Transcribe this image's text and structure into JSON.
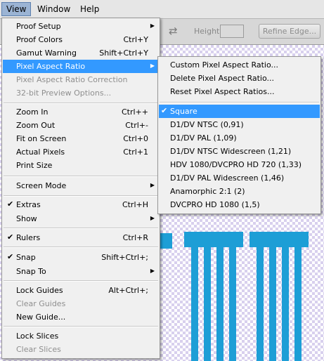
{
  "menubar": {
    "items": [
      "View",
      "Window",
      "Help"
    ]
  },
  "optionsbar": {
    "height_label": "Height:",
    "refine_label": "Refine Edge..."
  },
  "view_menu": {
    "items": [
      {
        "label": "Proof Setup",
        "shortcut": "",
        "submenu": true,
        "checked": false,
        "disabled": false
      },
      {
        "label": "Proof Colors",
        "shortcut": "Ctrl+Y",
        "submenu": false,
        "checked": false,
        "disabled": false
      },
      {
        "label": "Gamut Warning",
        "shortcut": "Shift+Ctrl+Y",
        "submenu": false,
        "checked": false,
        "disabled": false
      },
      {
        "label": "Pixel Aspect Ratio",
        "shortcut": "",
        "submenu": true,
        "checked": false,
        "disabled": false,
        "highlighted": true
      },
      {
        "label": "Pixel Aspect Ratio Correction",
        "shortcut": "",
        "submenu": false,
        "checked": false,
        "disabled": true
      },
      {
        "label": "32-bit Preview Options...",
        "shortcut": "",
        "submenu": false,
        "checked": false,
        "disabled": true
      },
      {
        "label": "Zoom In",
        "shortcut": "Ctrl++",
        "submenu": false,
        "checked": false,
        "disabled": false
      },
      {
        "label": "Zoom Out",
        "shortcut": "Ctrl+-",
        "submenu": false,
        "checked": false,
        "disabled": false
      },
      {
        "label": "Fit on Screen",
        "shortcut": "Ctrl+0",
        "submenu": false,
        "checked": false,
        "disabled": false
      },
      {
        "label": "Actual Pixels",
        "shortcut": "Ctrl+1",
        "submenu": false,
        "checked": false,
        "disabled": false
      },
      {
        "label": "Print Size",
        "shortcut": "",
        "submenu": false,
        "checked": false,
        "disabled": false
      },
      {
        "label": "Screen Mode",
        "shortcut": "",
        "submenu": true,
        "checked": false,
        "disabled": false
      },
      {
        "label": "Extras",
        "shortcut": "Ctrl+H",
        "submenu": false,
        "checked": true,
        "disabled": false
      },
      {
        "label": "Show",
        "shortcut": "",
        "submenu": true,
        "checked": false,
        "disabled": false
      },
      {
        "label": "Rulers",
        "shortcut": "Ctrl+R",
        "submenu": false,
        "checked": true,
        "disabled": false
      },
      {
        "label": "Snap",
        "shortcut": "Shift+Ctrl+;",
        "submenu": false,
        "checked": true,
        "disabled": false
      },
      {
        "label": "Snap To",
        "shortcut": "",
        "submenu": true,
        "checked": false,
        "disabled": false
      },
      {
        "label": "Lock Guides",
        "shortcut": "Alt+Ctrl+;",
        "submenu": false,
        "checked": false,
        "disabled": false
      },
      {
        "label": "Clear Guides",
        "shortcut": "",
        "submenu": false,
        "checked": false,
        "disabled": true
      },
      {
        "label": "New Guide...",
        "shortcut": "",
        "submenu": false,
        "checked": false,
        "disabled": false
      },
      {
        "label": "Lock Slices",
        "shortcut": "",
        "submenu": false,
        "checked": false,
        "disabled": false
      },
      {
        "label": "Clear Slices",
        "shortcut": "",
        "submenu": false,
        "checked": false,
        "disabled": true
      }
    ]
  },
  "pixel_aspect_submenu": {
    "items": [
      {
        "label": "Custom Pixel Aspect Ratio...",
        "checked": false
      },
      {
        "label": "Delete Pixel Aspect Ratio...",
        "checked": false
      },
      {
        "label": "Reset Pixel Aspect Ratios...",
        "checked": false
      },
      {
        "label": "Square",
        "checked": true,
        "highlighted": true
      },
      {
        "label": "D1/DV NTSC (0,91)",
        "checked": false
      },
      {
        "label": "D1/DV PAL (1,09)",
        "checked": false
      },
      {
        "label": "D1/DV NTSC Widescreen (1,21)",
        "checked": false
      },
      {
        "label": "HDV 1080/DVCPRO HD 720 (1,33)",
        "checked": false
      },
      {
        "label": "D1/DV PAL Widescreen (1,46)",
        "checked": false
      },
      {
        "label": "Anamorphic 2:1 (2)",
        "checked": false
      },
      {
        "label": "DVCPRO HD 1080 (1,5)",
        "checked": false
      }
    ]
  },
  "icons": {
    "check": "checkmark-icon",
    "submenu": "submenu-arrow-icon",
    "swap": "swap-arrows-icon"
  },
  "colors": {
    "highlight": "#3399ff",
    "artwork": "#1d9ed6",
    "disabled_text": "#8f8f8f"
  }
}
